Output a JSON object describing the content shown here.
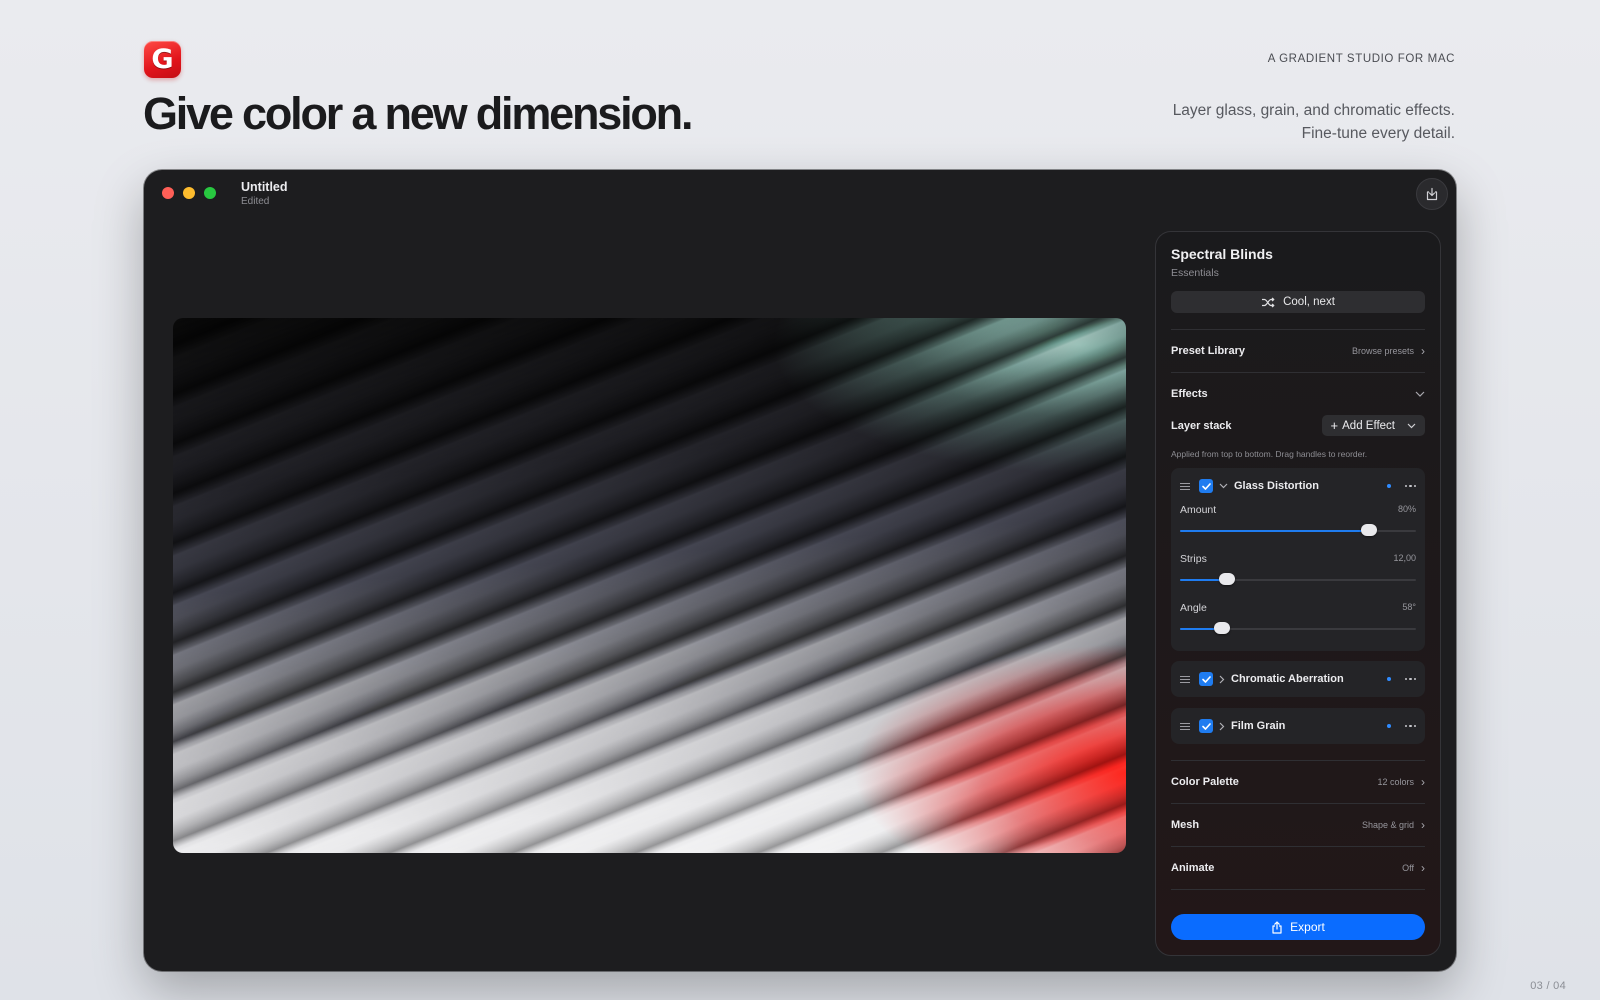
{
  "brand": {
    "logo_letter": "G",
    "tagline": "A GRADIENT STUDIO FOR MAC"
  },
  "hero": {
    "title": "Give color a new dimension.",
    "subtitle_lines": [
      "Layer glass, grain, and chromatic effects.",
      "Fine-tune every detail."
    ]
  },
  "window": {
    "doc_name": "Untitled",
    "doc_status": "Edited",
    "share_icon": "share-tray-icon"
  },
  "panel": {
    "preset_name": "Spectral Blinds",
    "preset_category": "Essentials",
    "shuffle_label": "Cool, next",
    "preset_library": {
      "label": "Preset Library",
      "value": "Browse presets"
    },
    "effects": {
      "label": "Effects",
      "layer_stack_label": "Layer stack",
      "add_effect_label": "Add Effect",
      "hint": "Applied from top to bottom. Drag handles to reorder.",
      "layers": [
        {
          "name": "Glass Distortion",
          "enabled": true,
          "expanded": true,
          "params": [
            {
              "label": "Amount",
              "value": "80%",
              "fraction": 0.8
            },
            {
              "label": "Strips",
              "value": "12,00",
              "fraction": 0.2
            },
            {
              "label": "Angle",
              "value": "58°",
              "fraction": 0.18
            }
          ]
        },
        {
          "name": "Chromatic Aberration",
          "enabled": true,
          "expanded": false
        },
        {
          "name": "Film Grain",
          "enabled": true,
          "expanded": false
        }
      ]
    },
    "color_palette": {
      "label": "Color Palette",
      "value": "12 colors"
    },
    "mesh": {
      "label": "Mesh",
      "value": "Shape & grid"
    },
    "animate": {
      "label": "Animate",
      "value": "Off"
    },
    "export_label": "Export"
  },
  "page_counter": "03 / 04",
  "colors": {
    "accent": "#0a6cff",
    "logo": "#e1141b"
  }
}
